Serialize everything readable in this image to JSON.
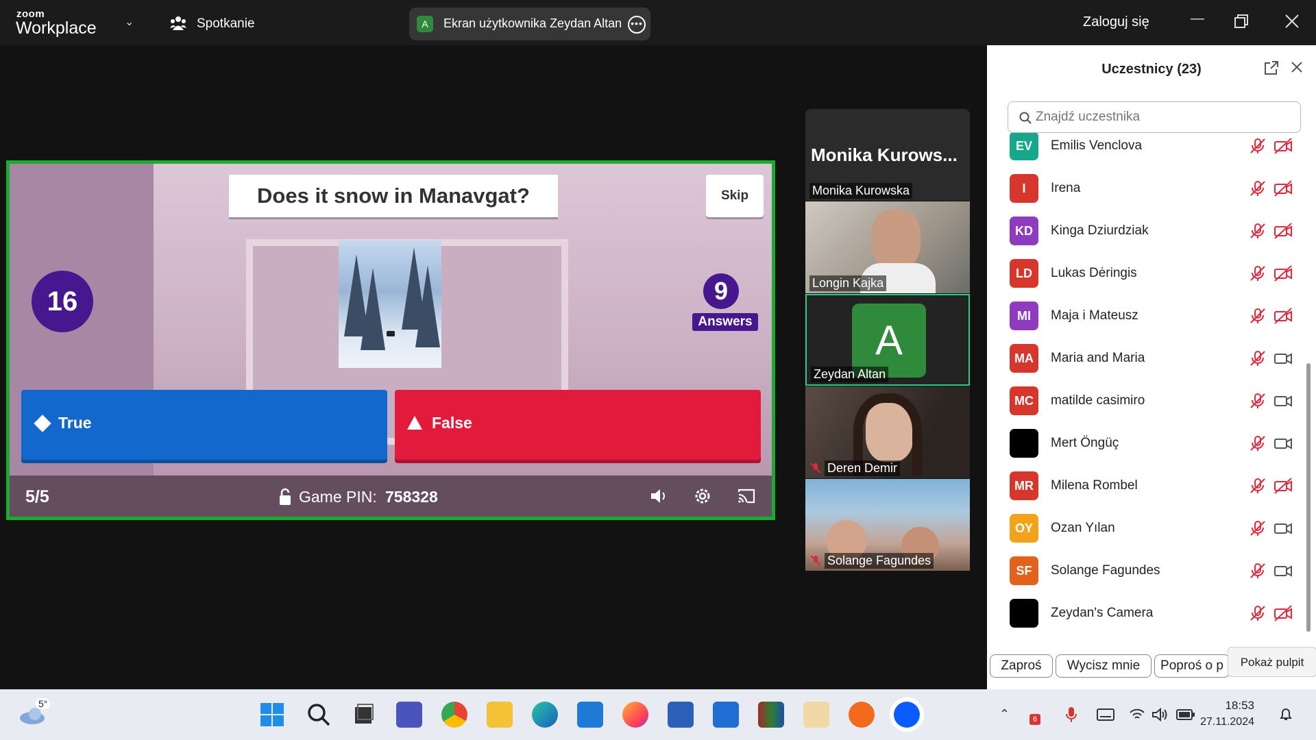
{
  "topbar": {
    "brand_small": "zoom",
    "brand_big": "Workplace",
    "meeting_label": "Spotkanie",
    "share_avatar": "A",
    "share_label": "Ekran użytkownika Zeydan Altan",
    "login_label": "Zaloguj się"
  },
  "game": {
    "question": "Does it snow in Manavgat?",
    "skip_label": "Skip",
    "timer": "16",
    "answer_count": "9",
    "answers_label": "Answers",
    "answer_true": "True",
    "answer_false": "False",
    "progress": "5/5",
    "pin_label": "Game PIN:",
    "pin_value": "758328"
  },
  "video_strip": {
    "active_speaker_large": "Monika  Kurows...",
    "tiles": [
      {
        "name": "Monika Kurowska",
        "muted": false
      },
      {
        "name": "Longin Kajka",
        "muted": false
      },
      {
        "name": "Zeydan Altan",
        "avatar": "A",
        "muted": false
      },
      {
        "name": "Deren Demir",
        "muted": true
      },
      {
        "name": "Solange Fagundes",
        "muted": true
      }
    ]
  },
  "participants": {
    "title": "Uczestnicy (23)",
    "search_placeholder": "Znajdź uczestnika",
    "items": [
      {
        "initials": "EV",
        "name": "Emilis Venclova",
        "color": "#17a88b",
        "cam_off": true
      },
      {
        "initials": "I",
        "name": "Irena",
        "color": "#d6362b",
        "cam_off": true
      },
      {
        "initials": "KD",
        "name": "Kinga Dziurdziak",
        "color": "#8e3bbf",
        "cam_off": true
      },
      {
        "initials": "LD",
        "name": "Lukas Dėringis",
        "color": "#d6362b",
        "cam_off": true
      },
      {
        "initials": "MI",
        "name": "Maja i Mateusz",
        "color": "#8e3bbf",
        "cam_off": true
      },
      {
        "initials": "MA",
        "name": "Maria and Maria",
        "color": "#d6362b",
        "cam_off": false
      },
      {
        "initials": "MC",
        "name": "matilde casimiro",
        "color": "#d6362b",
        "cam_off": false
      },
      {
        "initials": "",
        "name": "Mert Öngüç",
        "color": "#000000",
        "cam_off": false
      },
      {
        "initials": "MR",
        "name": "Milena Rombel",
        "color": "#d6362b",
        "cam_off": true
      },
      {
        "initials": "OY",
        "name": "Ozan Yılan",
        "color": "#f2a31b",
        "cam_off": false
      },
      {
        "initials": "SF",
        "name": "Solange Fagundes",
        "color": "#e3621b",
        "cam_off": false
      },
      {
        "initials": "",
        "name": "Zeydan's Camera",
        "color": "#000000",
        "cam_off": true
      }
    ],
    "buttons": {
      "invite": "Zaproś",
      "mute_me": "Wycisz mnie",
      "request": "Poproś o p"
    },
    "tooltip": "Pokaż pulpit"
  },
  "taskbar": {
    "temperature": "5°",
    "time": "18:53",
    "date": "27.11.2024",
    "notification_badge": "6"
  },
  "colors": {
    "kahoot_purple": "#46178f",
    "true_blue": "#1368ce",
    "false_red": "#e21b3c",
    "share_border_green": "#1bab30",
    "mute_red": "#e0283a"
  }
}
